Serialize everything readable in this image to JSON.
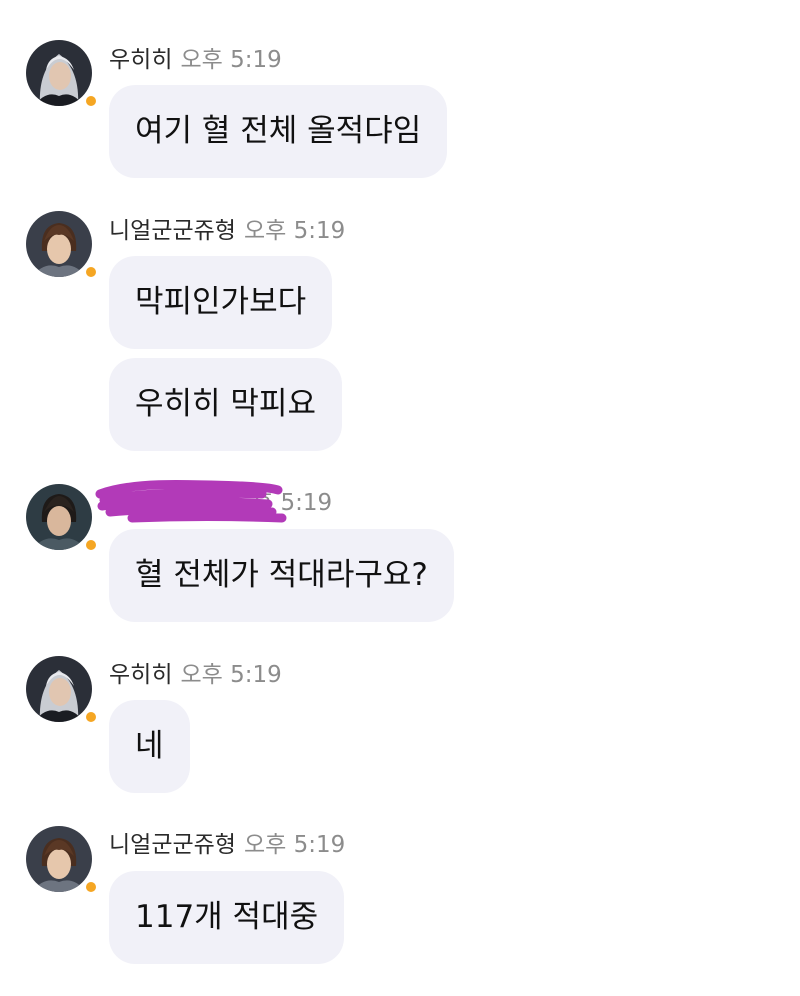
{
  "colors": {
    "bubble": "#f1f1f8",
    "status_dot": "#f5a623",
    "time_text": "#8c8c8c",
    "redaction": "#b23ab8"
  },
  "messages": [
    {
      "avatar": "silver-hair-character-avatar",
      "sender": "우히히",
      "time": "오후 5:19",
      "bubbles": [
        "여기 혈 전체 올적댜임"
      ]
    },
    {
      "avatar": "brown-hair-character-avatar",
      "sender": "니얼군군쥬형",
      "time": "오후 5:19",
      "bubbles": [
        "막피인가보다",
        "우히히 막피요"
      ]
    },
    {
      "avatar": "dark-hair-character-avatar",
      "sender": "",
      "sender_redacted": true,
      "time": "후 5:19",
      "bubbles": [
        "혈 전체가 적대라구요?"
      ]
    },
    {
      "avatar": "silver-hair-character-avatar",
      "sender": "우히히",
      "time": "오후 5:19",
      "bubbles": [
        "네"
      ]
    },
    {
      "avatar": "brown-hair-character-avatar",
      "sender": "니얼군군쥬형",
      "time": "오후 5:19",
      "bubbles": [
        "117개 적대중"
      ]
    }
  ]
}
